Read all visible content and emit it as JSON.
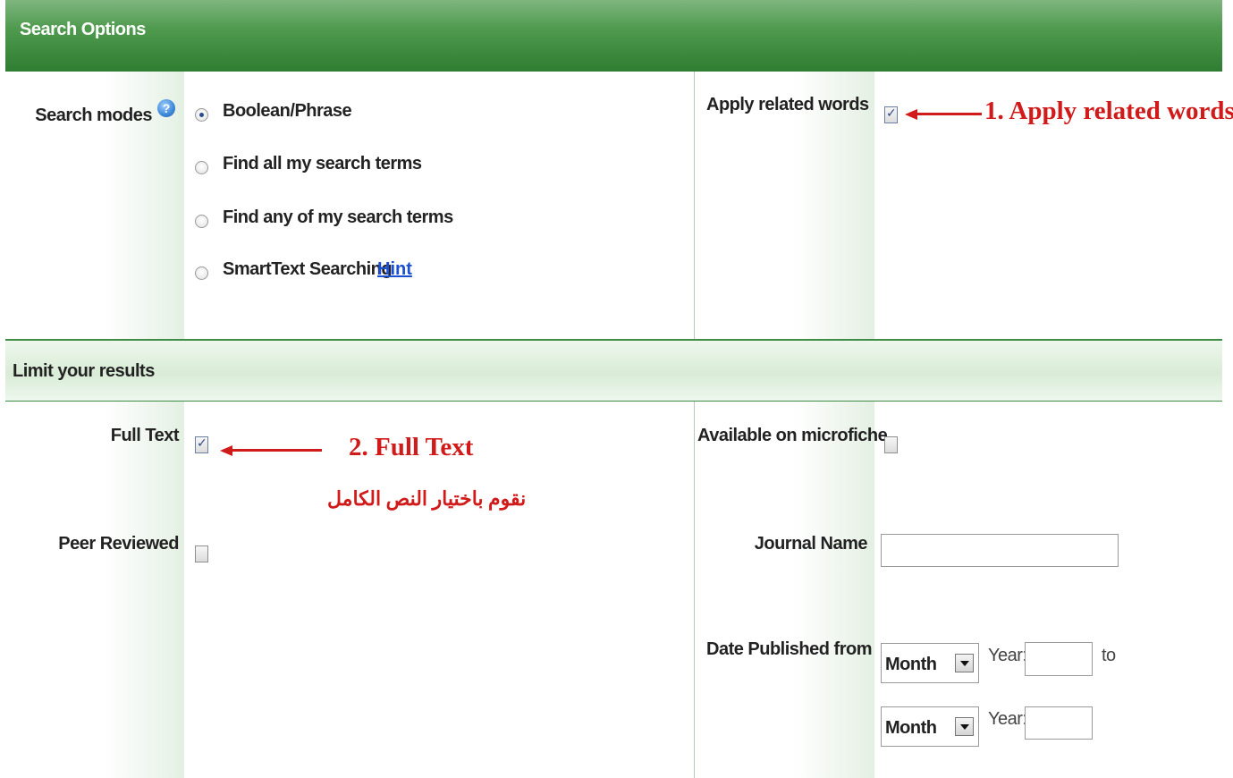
{
  "header": {
    "title": "Search Options"
  },
  "search_modes": {
    "label": "Search modes",
    "options": [
      {
        "label": "Boolean/Phrase",
        "checked": true
      },
      {
        "label": "Find all my search terms",
        "checked": false
      },
      {
        "label": "Find any of my search terms",
        "checked": false
      },
      {
        "label": "SmartText Searching",
        "checked": false
      }
    ],
    "hint_link": "Hint"
  },
  "apply_related": {
    "label": "Apply related words",
    "checked": true
  },
  "limit": {
    "title": "Limit your results",
    "full_text": {
      "label": "Full Text",
      "checked": true
    },
    "peer_reviewed": {
      "label": "Peer Reviewed",
      "checked": false
    },
    "microfiche": {
      "label": "Available on microfiche",
      "checked": false
    },
    "journal_name": {
      "label": "Journal Name",
      "value": ""
    },
    "date_published": {
      "label": "Date Published from",
      "from_month": "Month",
      "from_year_label": "Year:",
      "to_label": "to",
      "to_month": "Month",
      "to_year_label": "Year:"
    }
  },
  "annotations": {
    "apply_related": "1. Apply related words",
    "full_text": "2. Full Text",
    "arabic_note": "نقوم باختيار النص الكامل"
  },
  "colors": {
    "header_green": "#2f7d32",
    "annotation_red": "#d11a1a",
    "link_blue": "#1a4fd1"
  }
}
